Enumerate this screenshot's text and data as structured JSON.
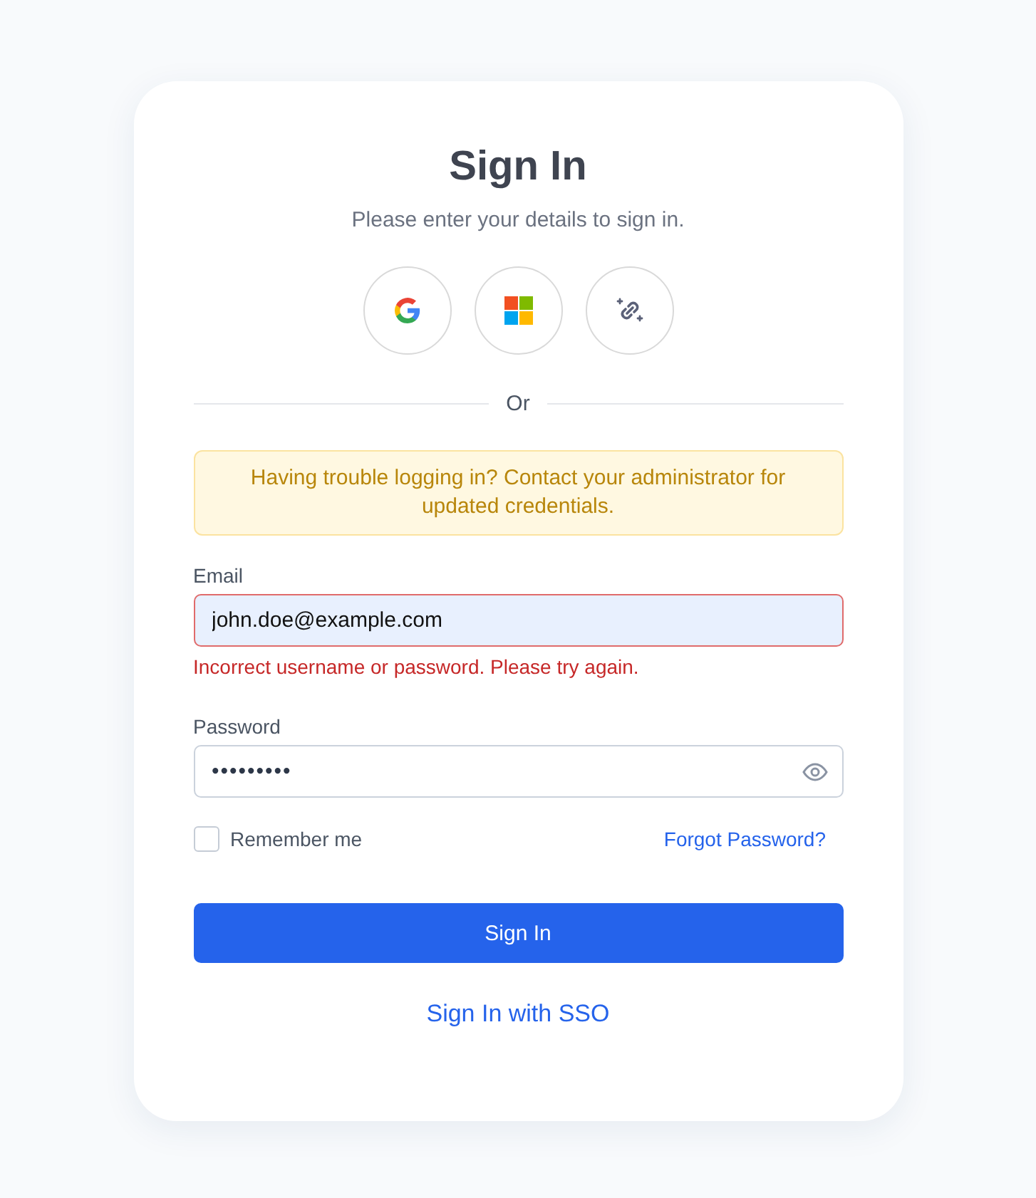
{
  "title": "Sign In",
  "subtitle": "Please enter your details to sign in.",
  "social_buttons": [
    {
      "kind": "google"
    },
    {
      "kind": "windows"
    },
    {
      "kind": "link"
    }
  ],
  "divider": "Or",
  "alert": "Having trouble logging in? Contact your administrator for updated credentials.",
  "fields": [
    {
      "kind": "email",
      "label": "Email",
      "value": "john.doe@example.com",
      "invalid": true,
      "autofilled": true,
      "error": "Incorrect username or password. Please try again."
    },
    {
      "kind": "password",
      "label": "Password",
      "value": "•••••••••",
      "invalid": false,
      "autofilled": false
    }
  ],
  "remember": {
    "label": "Remember me",
    "checked": false
  },
  "forgot_link": "Forgot Password?",
  "submit": "Sign In",
  "sso_link": "Sign In with SSO"
}
